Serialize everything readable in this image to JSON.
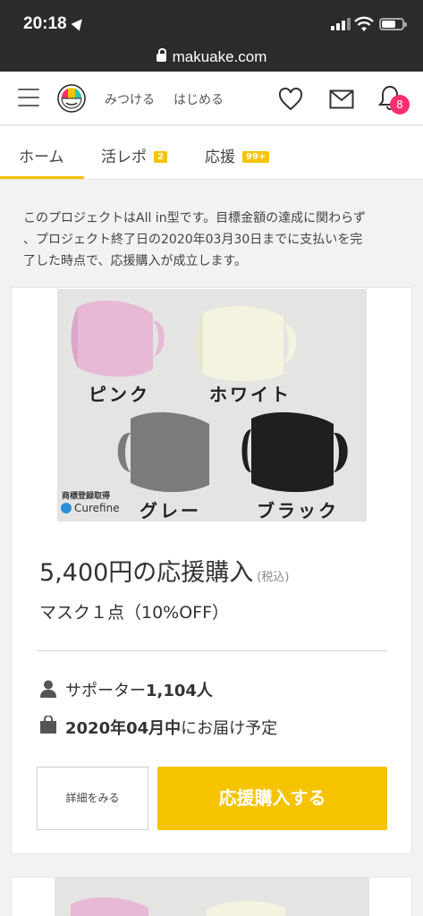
{
  "status_bar": {
    "time": "20:18"
  },
  "browser": {
    "url": "makuake.com"
  },
  "header": {
    "nav_links": [
      "みつける",
      "はじめる"
    ],
    "notification_count": "8"
  },
  "tabs": [
    {
      "label": "ホーム",
      "badge": ""
    },
    {
      "label": "活レポ",
      "badge": "2"
    },
    {
      "label": "応援",
      "badge": "99+"
    }
  ],
  "notice": {
    "lines": [
      "このプロジェクトはAll in型です。目標金額の達成に関わらず",
      "、プロジェクト終了日の2020年03月30日までに支払いを完",
      "了した時点で、応援購入が成立します。"
    ]
  },
  "reward": {
    "image": {
      "labels": [
        "ピンク",
        "ホワイト",
        "グレー",
        "ブラック"
      ],
      "trademark": "商標登録取得",
      "brand": "Curefine"
    },
    "price": "5,400円の応援購入",
    "tax_note": "(税込)",
    "description": "マスク１点（10%OFF）",
    "supporters_prefix": "サポーター",
    "supporters_count": "1,104人",
    "delivery_date": "2020年04月中",
    "delivery_suffix": "にお届け予定",
    "details_button": "詳細をみる",
    "buy_button": "応援購入する"
  },
  "colors": {
    "accent": "#f5c300",
    "badge_pink": "#ff2d6b",
    "mask_pink": "#e7b9d6",
    "mask_white": "#f3f3df",
    "mask_gray": "#7b7b7b",
    "mask_black": "#1f1f1f"
  }
}
